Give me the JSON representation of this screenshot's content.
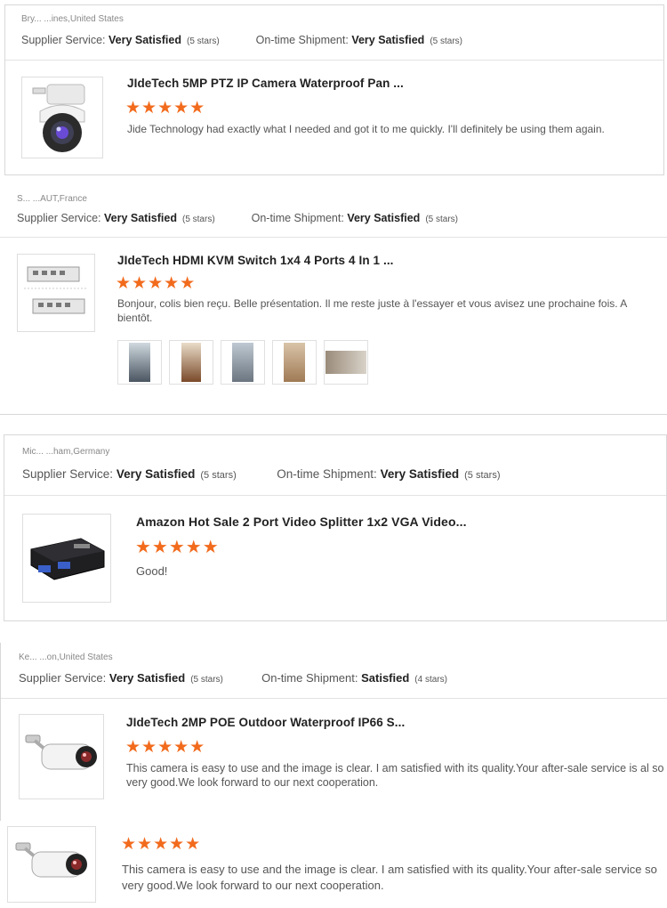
{
  "labels": {
    "supplier_service": "Supplier Service:",
    "ontime_shipment": "On-time Shipment:"
  },
  "colors": {
    "star": "#f26b1d",
    "border": "#d8d8d8"
  },
  "reviews": [
    {
      "location": "Bry... ...ines,United States",
      "supplier_rating": "Very Satisfied",
      "supplier_stars": "(5 stars)",
      "shipment_rating": "Very Satisfied",
      "shipment_stars": "(5 stars)",
      "product_title": "JIdeTech 5MP PTZ IP Camera Waterproof Pan ...",
      "stars": "★★★★★",
      "text": "Jide Technology had exactly what I needed and got it to me quickly. I'll definitely be using them again.",
      "icon": "ptz-camera-icon"
    },
    {
      "location": "S... ...AUT,France",
      "supplier_rating": "Very Satisfied",
      "supplier_stars": "(5 stars)",
      "shipment_rating": "Very Satisfied",
      "shipment_stars": "(5 stars)",
      "product_title": "JIdeTech HDMI KVM Switch 1x4 4 Ports 4 In 1 ...",
      "stars": "★★★★★",
      "text": "Bonjour, colis bien reçu. Belle présentation. Il me reste juste à l'essayer et vous avisez une prochaine fois. A bientôt.",
      "icon": "kvm-switch-icon"
    },
    {
      "location": "Mic... ...ham,Germany",
      "supplier_rating": "Very Satisfied",
      "supplier_stars": "(5 stars)",
      "shipment_rating": "Very Satisfied",
      "shipment_stars": "(5 stars)",
      "product_title": "Amazon Hot Sale 2 Port Video Splitter 1x2 VGA Video...",
      "stars": "★★★★★",
      "text": "Good!",
      "icon": "vga-splitter-icon"
    },
    {
      "location": "Ke... ...on,United States",
      "supplier_rating": "Very Satisfied",
      "supplier_stars": "(5 stars)",
      "shipment_rating": "Satisfied",
      "shipment_stars": "(4 stars)",
      "product_title": "JIdeTech 2MP POE Outdoor Waterproof IP66 S...",
      "stars": "★★★★★",
      "text": "This camera is easy to use and the image is clear. I am satisfied with its quality.Your after-sale service is al so very good.We look forward to our next cooperation.",
      "icon": "bullet-camera-icon"
    },
    {
      "stars": "★★★★★",
      "text": "This camera is easy to use and the image is clear. I am satisfied with its quality.Your after-sale service so very good.We look forward to our next cooperation.",
      "icon": "bullet-camera-icon"
    }
  ]
}
